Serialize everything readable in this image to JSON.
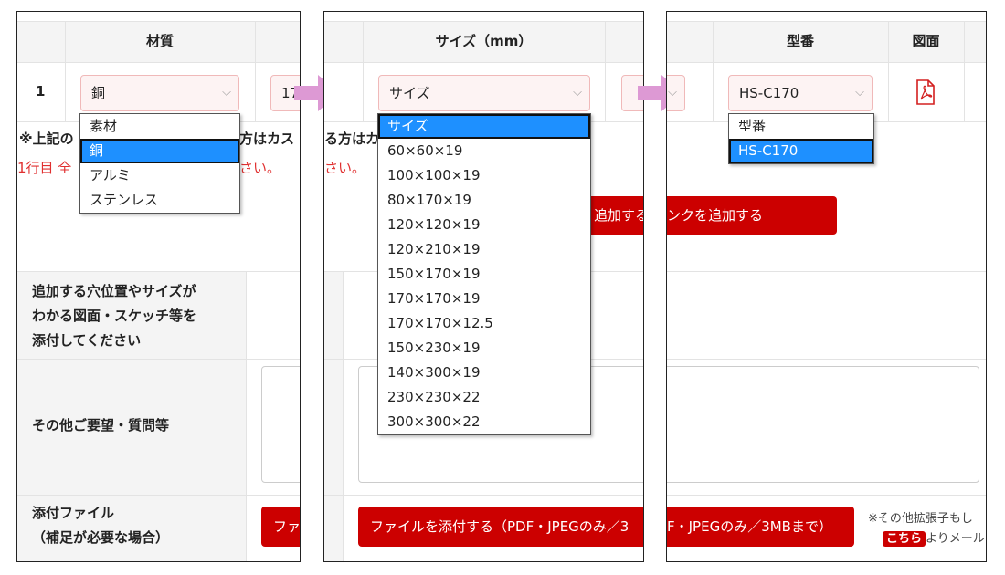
{
  "panel1": {
    "header_material": "材質",
    "row_number": "1",
    "material_select": "銅",
    "size_partial": "17",
    "material_options": [
      "素材",
      "銅",
      "アルミ",
      "ステンレス"
    ],
    "note_prefix": "※上記の",
    "note_suffix": "方はカス",
    "note_suffix2": "る方はカ",
    "warning_prefix": "1行目 全",
    "warning_suffix": "さい。",
    "attach_hole_label": [
      "追加する穴位置やサイズが",
      "わかる図面・スケッチ等を",
      "添付してください"
    ],
    "other_requests_label": "その他ご要望・質問等",
    "attach_file_label": [
      "添付ファイル",
      "（補足が必要な場合）"
    ],
    "attach_button_partial": "ファ"
  },
  "panel2": {
    "header_size": "サイズ（mm）",
    "size_select": "サイズ",
    "size_options": [
      "サイズ",
      "60×60×19",
      "100×100×19",
      "80×170×19",
      "120×120×19",
      "120×210×19",
      "150×170×19",
      "170×170×19",
      "170×170×12.5",
      "150×230×19",
      "140×300×19",
      "230×230×22",
      "300×300×22"
    ],
    "warning_partial": "さい。",
    "add_button_partial": "追加する",
    "attach_button": "ファイルを添付する（PDF・JPEGのみ／3"
  },
  "panel3": {
    "header_model": "型番",
    "header_drawing": "図面",
    "model_select": "HS-C170",
    "model_options": [
      "型番",
      "HS-C170"
    ],
    "add_sink_button": "ンクを追加する",
    "attach_button_partial": "F・JPEGのみ／3MBまで）",
    "other_ext_note": "※その他拡張子もし",
    "kochira": "こちら",
    "mail_suffix": "よりメール"
  },
  "colors": {
    "accent_red": "#cc0000",
    "arrow_pink": "#dd99d4",
    "selected_blue": "#1e90ff"
  },
  "icons": {
    "pdf": "pdf-file-icon",
    "chevron": "chevron-down-icon",
    "arrow": "right-arrow-icon"
  }
}
